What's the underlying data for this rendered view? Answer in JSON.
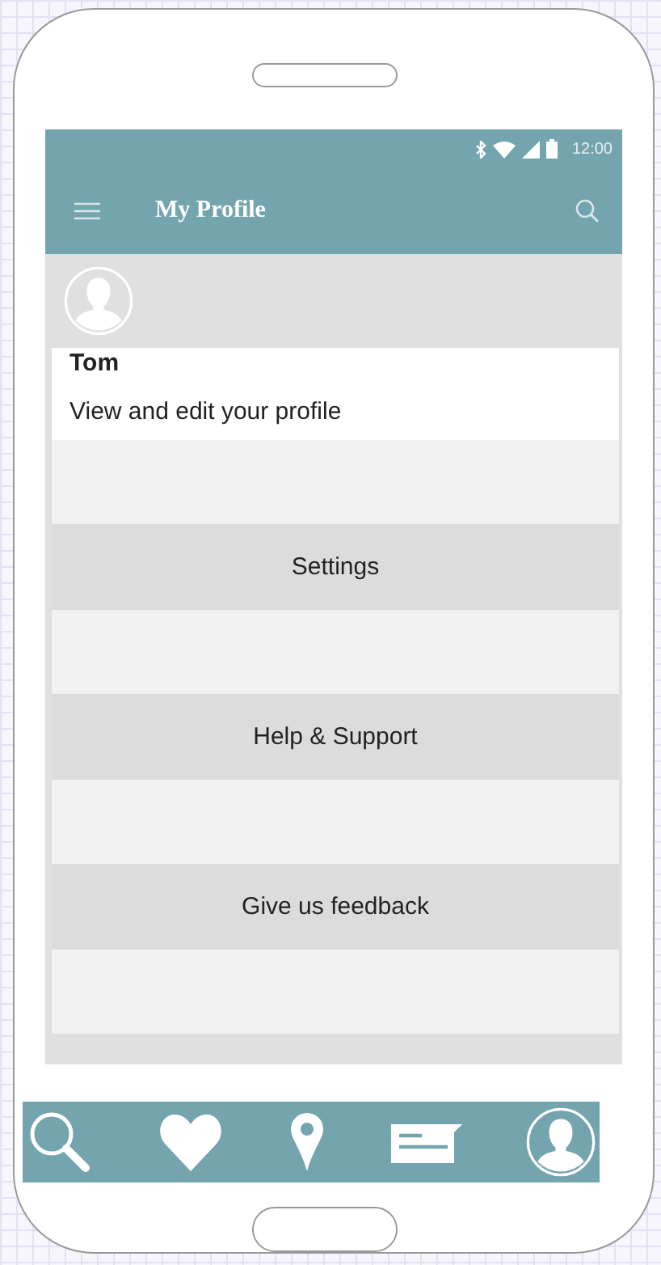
{
  "status_bar": {
    "time": "12:00"
  },
  "app_bar": {
    "title": "My Profile"
  },
  "profile": {
    "name": "Tom",
    "subtitle": "View and edit your profile"
  },
  "menu_items": [
    {
      "label": "Settings"
    },
    {
      "label": "Help & Support"
    },
    {
      "label": "Give us feedback"
    }
  ]
}
